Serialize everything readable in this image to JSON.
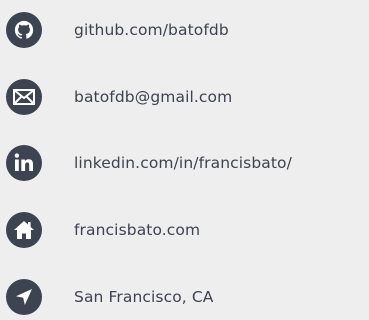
{
  "contacts": [
    {
      "icon": "github-icon",
      "label": "github.com/batofdb"
    },
    {
      "icon": "mail-icon",
      "label": "batofdb@gmail.com"
    },
    {
      "icon": "linkedin-icon",
      "label": "linkedin.com/in/francisbato/"
    },
    {
      "icon": "home-icon",
      "label": "francisbato.com"
    },
    {
      "icon": "location-arrow-icon",
      "label": "San Francisco, CA"
    }
  ],
  "colors": {
    "icon_background": "#3d4350",
    "text": "#3d4350",
    "page_background": "#eeeeee"
  }
}
